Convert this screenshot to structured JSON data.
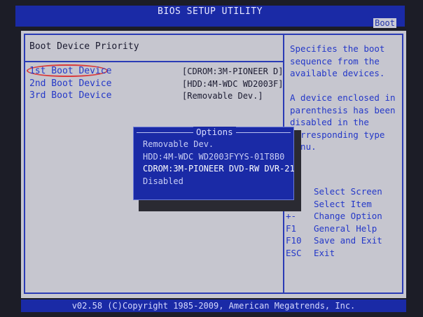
{
  "header": {
    "title": "BIOS SETUP UTILITY",
    "active_tab": "Boot"
  },
  "section": {
    "title": "Boot Device Priority"
  },
  "rows": [
    {
      "label": "1st Boot Device",
      "value": "[CDROM:3M-PIONEER D]"
    },
    {
      "label": "2nd Boot Device",
      "value": "[HDD:4M-WDC WD2003F]"
    },
    {
      "label": "3rd Boot Device",
      "value": "[Removable Dev.]"
    }
  ],
  "help": {
    "lines": [
      "Specifies the boot",
      "sequence from the",
      "available devices.",
      "",
      "A device enclosed in",
      "parenthesis has been",
      "disabled in the",
      "corresponding type",
      "menu."
    ],
    "keys": [
      {
        "key": "",
        "desc": "Select Screen"
      },
      {
        "key": "↑↓",
        "desc": "Select Item"
      },
      {
        "key": "+-",
        "desc": "Change Option"
      },
      {
        "key": "F1",
        "desc": "General Help"
      },
      {
        "key": "F10",
        "desc": "Save and Exit"
      },
      {
        "key": "ESC",
        "desc": "Exit"
      }
    ]
  },
  "popup": {
    "title": "Options",
    "options": [
      "Removable Dev.",
      "HDD:4M-WDC WD2003FYYS-01T8B0",
      "CDROM:3M-PIONEER DVD-RW DVR-21",
      "Disabled"
    ],
    "selected_index": 2
  },
  "footer": {
    "text": "v02.58 (C)Copyright 1985-2009, American Megatrends, Inc."
  }
}
